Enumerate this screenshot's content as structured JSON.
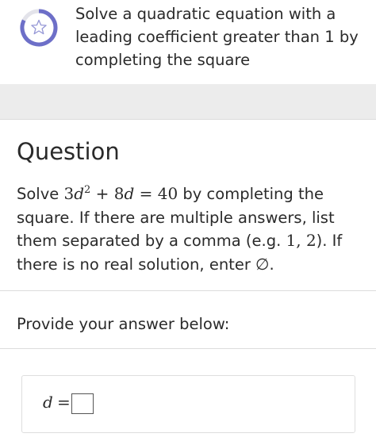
{
  "header": {
    "title": "Solve a quadratic equation with a leading coefficient greater than 1 by completing the square",
    "progress_icon": "star-icon",
    "progress_ring_color": "#6d6fc8",
    "progress_track_color": "#e3e3ea"
  },
  "question": {
    "heading": "Question",
    "body": {
      "t1": "Solve ",
      "eq_coef": "3",
      "eq_var1": "d",
      "eq_exp": "2",
      "eq_plus": " + 8",
      "eq_var2": "d",
      "eq_equals": " = 40",
      "t2": " by completing the square. If there are multiple answers, list them separated by a comma (e.g. ",
      "example": "1, 2",
      "t3": "). If there is no real solution, enter ",
      "empty_set": "∅",
      "t4": "."
    }
  },
  "answer": {
    "prompt": "Provide your answer below:",
    "variable": "d",
    "equals": "=",
    "value": ""
  }
}
